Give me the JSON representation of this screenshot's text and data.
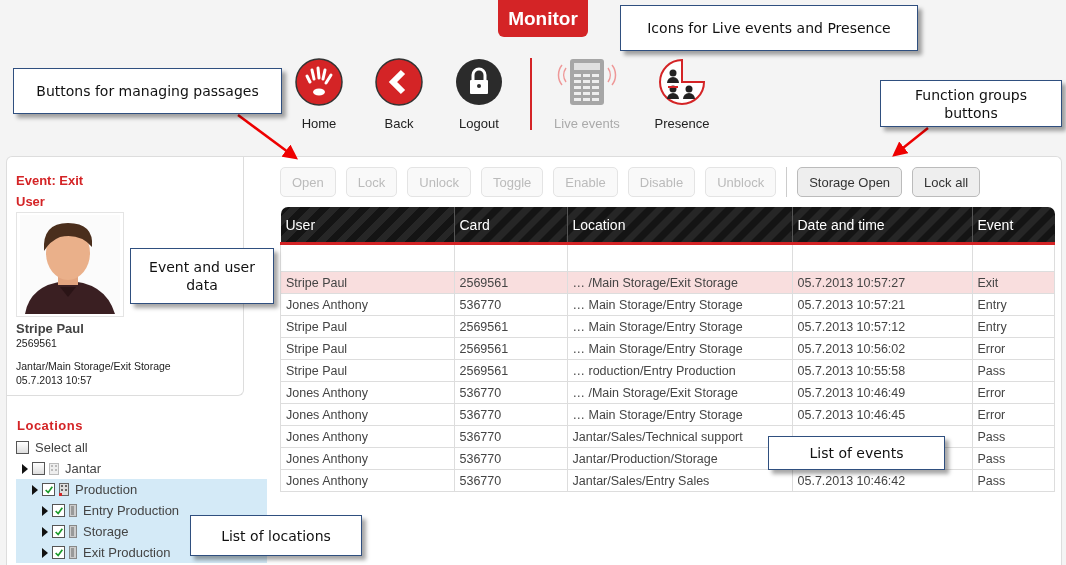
{
  "header_tab": {
    "label": "Monitor"
  },
  "nav_main": [
    {
      "label": "Home",
      "kind": "home",
      "disabled": false
    },
    {
      "label": "Back",
      "kind": "back",
      "disabled": false
    },
    {
      "label": "Logout",
      "kind": "logout",
      "disabled": false
    }
  ],
  "nav_views": [
    {
      "label": "Live events",
      "kind": "live",
      "disabled": true
    },
    {
      "label": "Presence",
      "kind": "presence",
      "disabled": false
    }
  ],
  "passage_buttons": [
    {
      "label": "Open",
      "disabled": true
    },
    {
      "label": "Lock",
      "disabled": true
    },
    {
      "label": "Unlock",
      "disabled": true
    },
    {
      "label": "Toggle",
      "disabled": true
    },
    {
      "label": "Enable",
      "disabled": true
    },
    {
      "label": "Disable",
      "disabled": true
    },
    {
      "label": "Unblock",
      "disabled": true
    }
  ],
  "group_buttons": [
    {
      "label": "Storage Open",
      "disabled": false
    },
    {
      "label": "Lock all",
      "disabled": false
    }
  ],
  "event_panel": {
    "title": "Event: Exit",
    "user_heading": "User",
    "name": "Stripe Paul",
    "card": "2569561",
    "location": "Jantar/Main Storage/Exit Storage",
    "time": "05.7.2013 10:57"
  },
  "locations": {
    "title": "Locations",
    "select_all": {
      "label": "Select all",
      "checked": false
    },
    "tree": [
      {
        "label": "Jantar",
        "kind": "site",
        "checked": false,
        "selected": false,
        "children": [
          {
            "label": "Production",
            "kind": "building",
            "checked": true,
            "selected": true,
            "children": [
              {
                "label": "Entry Production",
                "kind": "door",
                "checked": true,
                "selected": true
              },
              {
                "label": "Storage",
                "kind": "door",
                "checked": true,
                "selected": true
              },
              {
                "label": "Exit Production",
                "kind": "door",
                "checked": true,
                "selected": true
              }
            ]
          }
        ]
      }
    ]
  },
  "table": {
    "columns": [
      "User",
      "Card",
      "Location",
      "Date and time",
      "Event"
    ],
    "rows": [
      {
        "selected": true,
        "cells": [
          "Stripe Paul",
          "2569561",
          "… /Main Storage/Exit Storage",
          "05.7.2013 10:57:27",
          "Exit"
        ]
      },
      {
        "selected": false,
        "cells": [
          "Jones Anthony",
          "536770",
          "… Main Storage/Entry Storage",
          "05.7.2013 10:57:21",
          "Entry"
        ]
      },
      {
        "selected": false,
        "cells": [
          "Stripe Paul",
          "2569561",
          "… Main Storage/Entry Storage",
          "05.7.2013 10:57:12",
          "Entry"
        ]
      },
      {
        "selected": false,
        "cells": [
          "Stripe Paul",
          "2569561",
          "… Main Storage/Entry Storage",
          "05.7.2013 10:56:02",
          "Error"
        ]
      },
      {
        "selected": false,
        "cells": [
          "Stripe Paul",
          "2569561",
          "… roduction/Entry Production",
          "05.7.2013 10:55:58",
          "Pass"
        ]
      },
      {
        "selected": false,
        "cells": [
          "Jones Anthony",
          "536770",
          "… /Main Storage/Exit Storage",
          "05.7.2013 10:46:49",
          "Error"
        ]
      },
      {
        "selected": false,
        "cells": [
          "Jones Anthony",
          "536770",
          "… Main Storage/Entry Storage",
          "05.7.2013 10:46:45",
          "Error"
        ]
      },
      {
        "selected": false,
        "cells": [
          "Jones Anthony",
          "536770",
          "Jantar/Sales/Technical support",
          null,
          "Pass"
        ]
      },
      {
        "selected": false,
        "cells": [
          "Jones Anthony",
          "536770",
          "Jantar/Production/Storage",
          null,
          "Pass"
        ]
      },
      {
        "selected": false,
        "cells": [
          "Jones Anthony",
          "536770",
          "Jantar/Sales/Entry Sales",
          "05.7.2013 10:46:42",
          "Pass"
        ]
      }
    ]
  },
  "callouts": [
    {
      "text": "Buttons for managing passages"
    },
    {
      "text": "Icons for Live events and Presence"
    },
    {
      "text": "Function groups buttons"
    },
    {
      "text": "Event and user data"
    },
    {
      "text": "List of events"
    },
    {
      "text": "List of locations"
    }
  ]
}
